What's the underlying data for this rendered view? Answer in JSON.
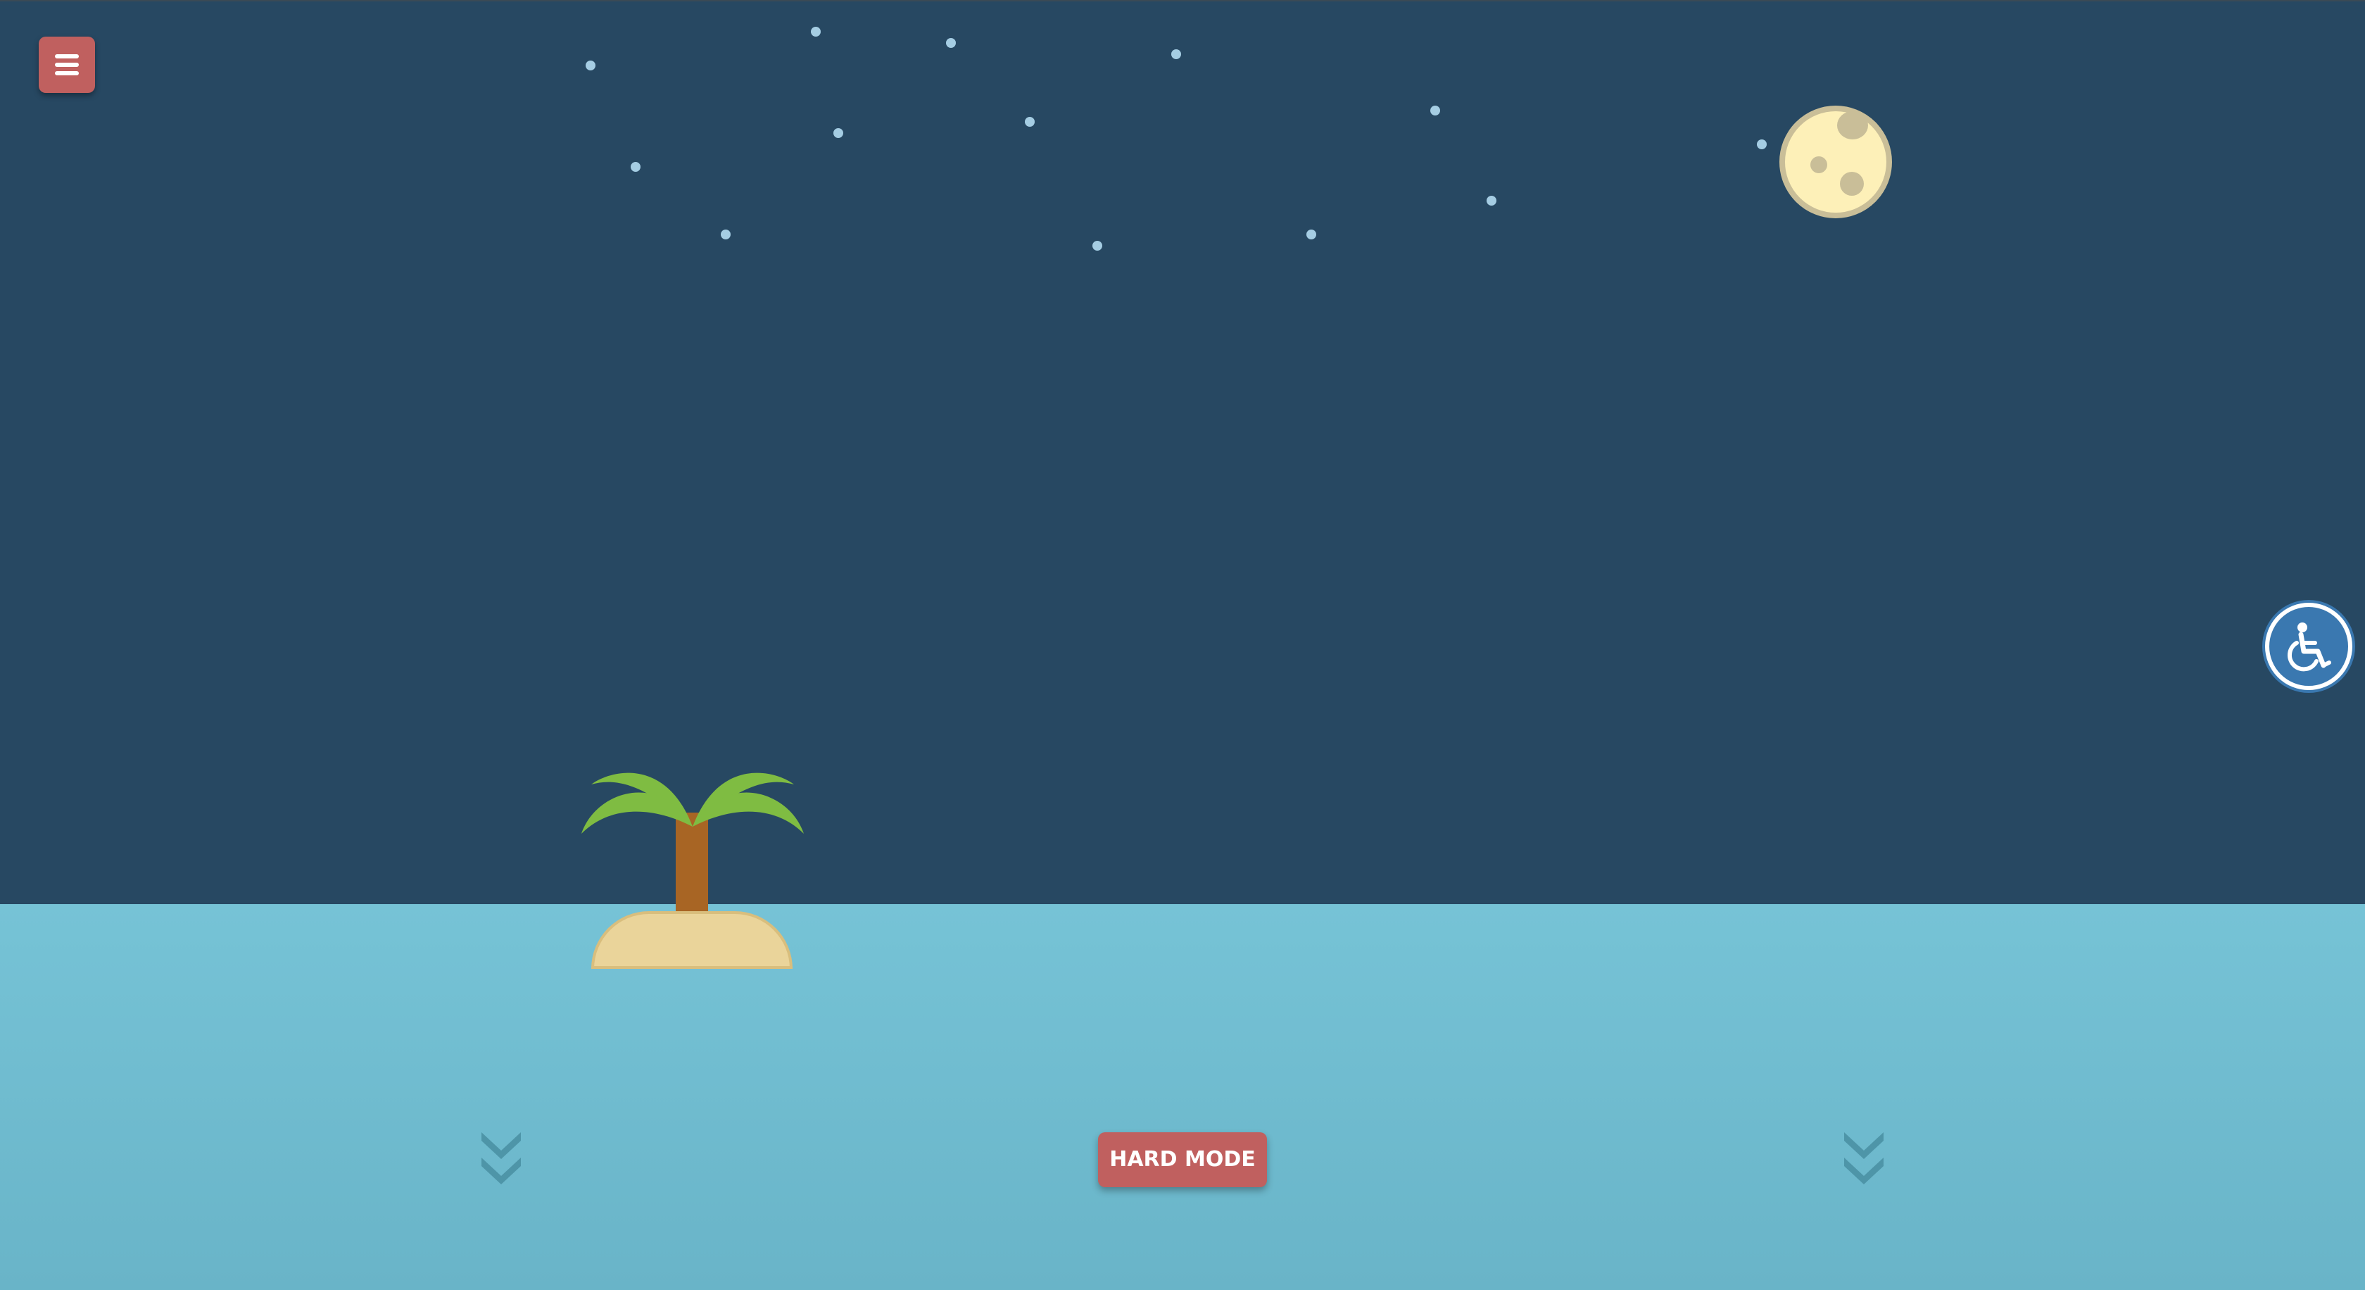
{
  "menu": {
    "icon": "hamburger-icon"
  },
  "sky": {
    "color": "#274862",
    "star_color": "#a5cde3"
  },
  "moon": {
    "icon": "moon-icon",
    "fill": "#fdf0b8",
    "crater_color": "#c9be98"
  },
  "accessibility": {
    "icon": "wheelchair-icon",
    "color": "#3a78b0"
  },
  "island": {
    "palm_icon": "palm-tree-icon",
    "sand_color": "#ead49a",
    "leaf_color": "#7fbc42",
    "trunk_color": "#a86524"
  },
  "sea": {
    "color": "#76c3d6"
  },
  "scroll_hints": {
    "icon": "double-chevron-down-icon"
  },
  "hard_mode_button": {
    "label": "HARD MODE",
    "color": "#c0605f"
  }
}
